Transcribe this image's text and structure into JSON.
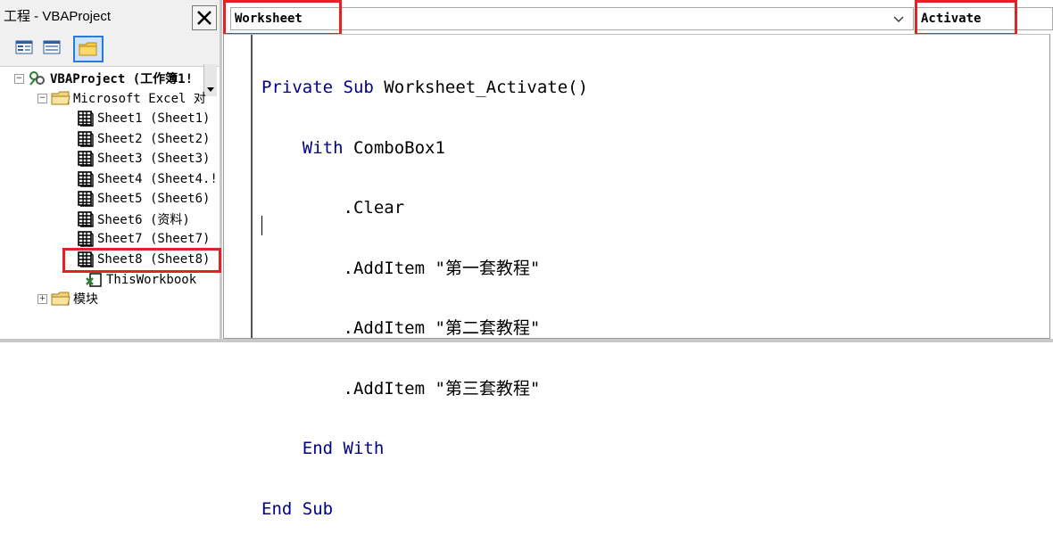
{
  "project_pane": {
    "title": "工程 - VBAProject",
    "tree": {
      "root": "VBAProject (工作簿1!",
      "excel_objects_folder": "Microsoft Excel 对",
      "sheets": [
        "Sheet1 (Sheet1)",
        "Sheet2 (Sheet2)",
        "Sheet3 (Sheet3)",
        "Sheet4 (Sheet4.!",
        "Sheet5 (Sheet6)",
        "Sheet6 (资料)",
        "Sheet7 (Sheet7)",
        "Sheet8 (Sheet8)"
      ],
      "this_workbook": "ThisWorkbook",
      "modules_folder": "模块"
    }
  },
  "code_window": {
    "object_dropdown": "Worksheet",
    "procedure_dropdown": "Activate",
    "lines": [
      {
        "kw1": "Private Sub",
        "rest": " Worksheet_Activate()"
      },
      {
        "indent": "    ",
        "kw1": "With",
        "rest": " ComboBox1"
      },
      {
        "indent": "        ",
        "rest": ".Clear"
      },
      {
        "indent": "        ",
        "rest": ".AddItem \"第一套教程\""
      },
      {
        "indent": "        ",
        "rest": ".AddItem \"第二套教程\""
      },
      {
        "indent": "        ",
        "rest": ".AddItem \"第三套教程\""
      },
      {
        "indent": "    ",
        "kw1": "End With",
        "rest": ""
      },
      {
        "kw1": "End Sub",
        "rest": ""
      }
    ]
  },
  "colors": {
    "keyword": "#00008b",
    "highlight_box": "#e02424"
  },
  "icons": [
    "close-icon",
    "view-code-icon",
    "view-object-icon",
    "toggle-folders-icon",
    "project-icon",
    "folder-icon",
    "sheet-icon",
    "workbook-icon"
  ]
}
